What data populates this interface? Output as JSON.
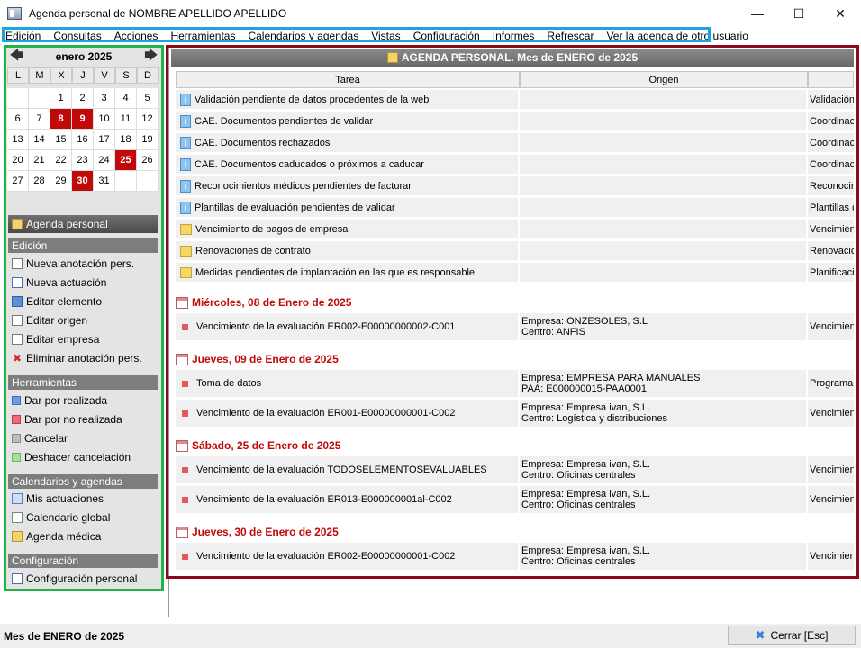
{
  "window": {
    "title": "Agenda personal de NOMBRE APELLIDO APELLIDO",
    "minimize": "—",
    "maximize": "☐",
    "close": "✕"
  },
  "menu": [
    "Edición",
    "Consultas",
    "Acciones",
    "Herramientas",
    "Calendarios y agendas",
    "Vistas",
    "Configuración",
    "Informes",
    "Refrescar",
    "Ver la agenda de otro usuario"
  ],
  "calendar": {
    "month_label": "enero 2025",
    "weekdays": [
      "L",
      "M",
      "X",
      "J",
      "V",
      "S",
      "D"
    ],
    "weeks": [
      [
        "",
        "",
        "1",
        "2",
        "3",
        "4",
        "5"
      ],
      [
        "6",
        "7",
        "8",
        "9",
        "10",
        "11",
        "12"
      ],
      [
        "13",
        "14",
        "15",
        "16",
        "17",
        "18",
        "19"
      ],
      [
        "20",
        "21",
        "22",
        "23",
        "24",
        "25",
        "26"
      ],
      [
        "27",
        "28",
        "29",
        "30",
        "31",
        "",
        ""
      ]
    ],
    "highlighted": [
      "8",
      "9",
      "25",
      "30"
    ]
  },
  "sidebar": {
    "agenda_button": "Agenda personal",
    "sections": [
      {
        "title": "Edición",
        "items": [
          "Nueva anotación pers.",
          "Nueva actuación",
          "Editar elemento",
          "Editar origen",
          "Editar empresa",
          "Eliminar anotación pers."
        ]
      },
      {
        "title": "Herramientas",
        "items": [
          "Dar por realizada",
          "Dar por no realizada",
          "Cancelar",
          "Deshacer cancelación"
        ]
      },
      {
        "title": "Calendarios y agendas",
        "items": [
          "Mis actuaciones",
          "Calendario global",
          "Agenda médica"
        ]
      },
      {
        "title": "Configuración",
        "items": [
          "Configuración personal"
        ]
      }
    ]
  },
  "main": {
    "header": "AGENDA PERSONAL. Mes de ENERO de 2025",
    "columns": [
      "Tarea",
      "Origen"
    ],
    "pending": [
      {
        "icon": "info",
        "tarea": "Validación pendiente de datos procedentes de la web",
        "extra": "Validación"
      },
      {
        "icon": "info",
        "tarea": "CAE. Documentos pendientes de validar",
        "extra": "Coordinaci"
      },
      {
        "icon": "info",
        "tarea": "CAE. Documentos rechazados",
        "extra": "Coordinaci"
      },
      {
        "icon": "info",
        "tarea": "CAE. Documentos caducados o próximos a caducar",
        "extra": "Coordinaci"
      },
      {
        "icon": "info",
        "tarea": "Reconocimientos médicos pendientes de facturar",
        "extra": "Reconocir"
      },
      {
        "icon": "info",
        "tarea": "Plantillas de evaluación pendientes de validar",
        "extra": "Plantillas d"
      },
      {
        "icon": "folder",
        "tarea": "Vencimiento de pagos de empresa",
        "extra": "Vencimien"
      },
      {
        "icon": "folder",
        "tarea": "Renovaciones de contrato",
        "extra": "Renovacio"
      },
      {
        "icon": "folder",
        "tarea": "Medidas pendientes de implantación en las que es responsable",
        "extra": "Planificacio"
      }
    ],
    "days": [
      {
        "date": "Miércoles, 08 de Enero de 2025",
        "rows": [
          {
            "tarea": "Vencimiento de la evaluación ER002-E00000000002-C001",
            "origen1": "Empresa: ONZESOLES, S.L",
            "origen2": "Centro: ANFIS",
            "extra": "Vencimien"
          }
        ]
      },
      {
        "date": "Jueves, 09 de Enero de 2025",
        "rows": [
          {
            "tarea": "Toma de datos",
            "origen1": "Empresa: EMPRESA PARA MANUALES",
            "origen2": "PAA: E000000015-PAA0001",
            "extra": "Programa ."
          },
          {
            "tarea": "Vencimiento de la evaluación ER001-E00000000001-C002",
            "origen1": "Empresa: Empresa ivan, S.L.",
            "origen2": "Centro: Logística y distribuciones",
            "extra": "Vencimien"
          }
        ]
      },
      {
        "date": "Sábado, 25 de Enero de 2025",
        "rows": [
          {
            "tarea": "Vencimiento de la evaluación TODOSELEMENTOSEVALUABLES",
            "origen1": "Empresa: Empresa ivan, S.L.",
            "origen2": "Centro: Oficinas centrales",
            "extra": "Vencimien"
          },
          {
            "tarea": "Vencimiento de la evaluación ER013-E000000001al-C002",
            "origen1": "Empresa: Empresa ivan, S.L.",
            "origen2": "Centro: Oficinas centrales",
            "extra": "Vencimien"
          }
        ]
      },
      {
        "date": "Jueves, 30 de Enero de 2025",
        "rows": [
          {
            "tarea": "Vencimiento de la evaluación ER002-E00000000001-C002",
            "origen1": "Empresa: Empresa ivan, S.L.",
            "origen2": "Centro: Oficinas centrales",
            "extra": "Vencimien"
          }
        ]
      }
    ]
  },
  "status": {
    "text": "Mes de ENERO de 2025",
    "close_button": "Cerrar [Esc]"
  }
}
